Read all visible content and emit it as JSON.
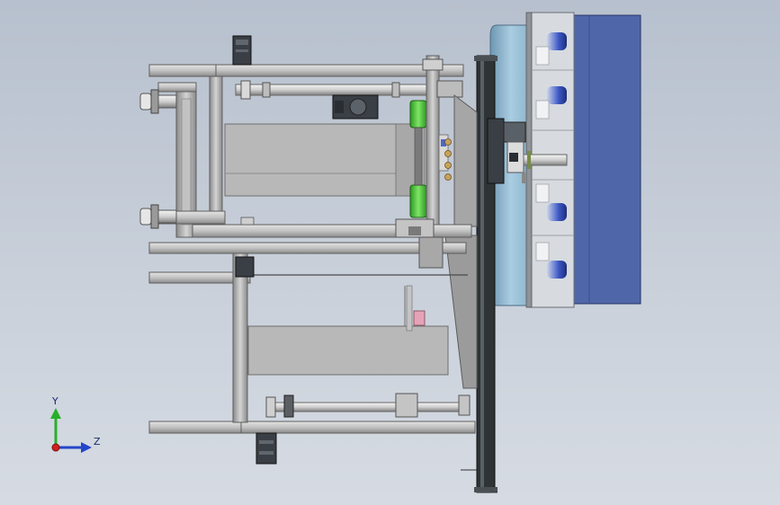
{
  "viewport": {
    "background_top": "#b7c0ce",
    "background_bottom": "#d6dbe3"
  },
  "colors": {
    "frame": "#c9c9c9",
    "frame_dark": "#6f6f6f",
    "panel": "#b8b8b8",
    "cover_light": "#9fc3d8",
    "cover_dark": "#5a7f99",
    "blue_block": "#4f67a8",
    "blue_roller": "#3b56c4",
    "green_cylinder": "#4fc93a",
    "motor_dark": "#3a3f45",
    "plate_dark": "#2e3336",
    "gold_knob": "#c8a25a",
    "pink_part": "#e6a3b8"
  },
  "orientation_triad": {
    "y_label": "Y",
    "z_label": "Z",
    "y_color": "#27b02a",
    "z_color": "#2346c9",
    "x_color": "#d02020"
  }
}
